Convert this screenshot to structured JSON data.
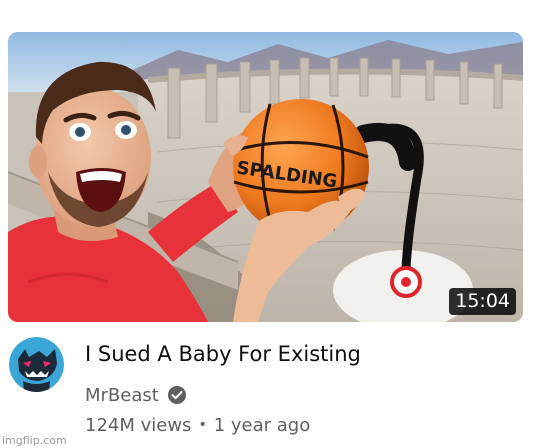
{
  "video": {
    "title": "I Sued A Baby For Existing",
    "duration": "15:04",
    "thumbnail_text": "SPALDING",
    "thumbnail_subject": "basketball-dam-shot-thumbnail"
  },
  "channel": {
    "name": "MrBeast",
    "verified_icon": "check-circle-icon",
    "avatar_icon": "beast-logo-icon"
  },
  "meta": {
    "views": "124M views",
    "separator": "•",
    "age": "1 year ago"
  },
  "watermark": {
    "text": "imgflip.com"
  },
  "colors": {
    "sky": "#9fc3e6",
    "shirt": "#e8323a",
    "ball": "#ee7a1f",
    "duration_bg": "#000000",
    "title": "#0f0f0f",
    "meta": "#5f5f5f",
    "avatar_bg": "#3aa6d8",
    "target": "#e0232b"
  }
}
